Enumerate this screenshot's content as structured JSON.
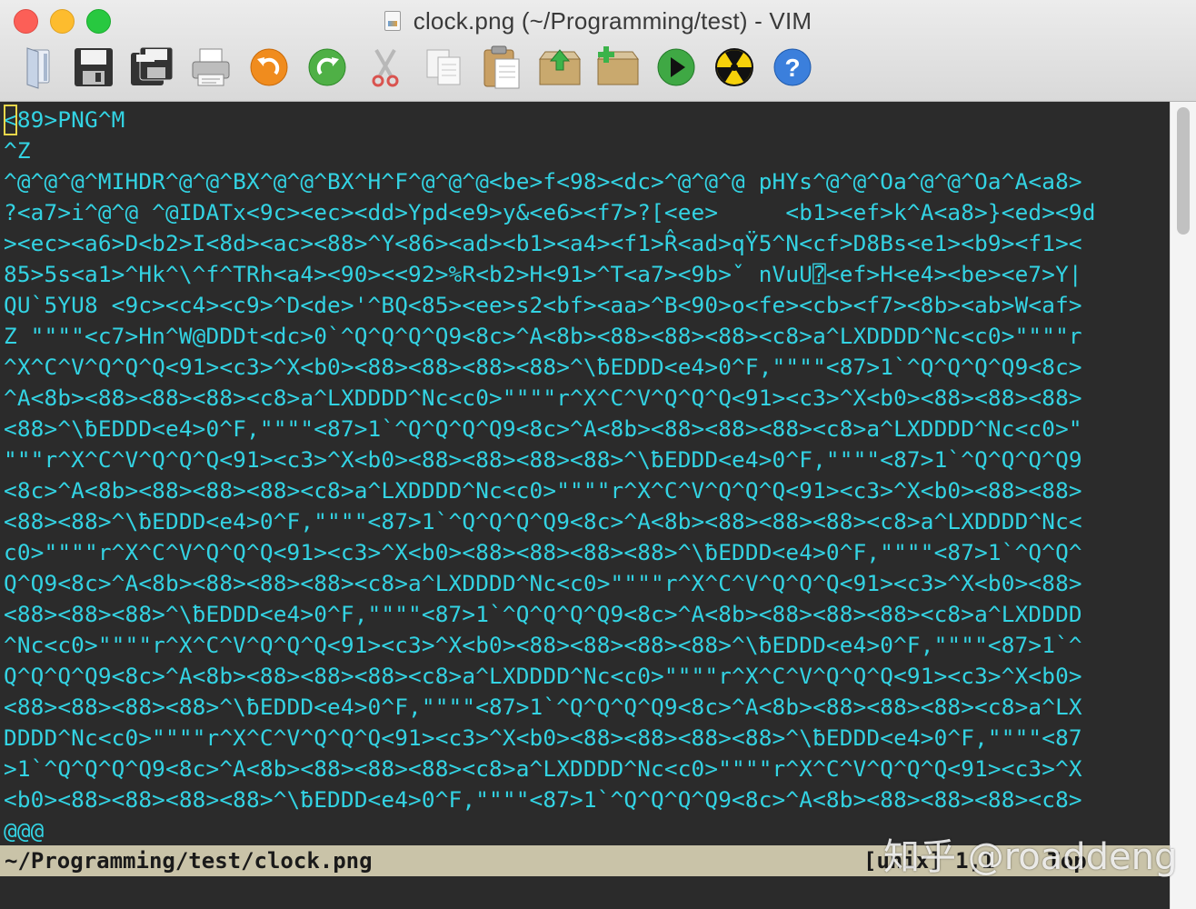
{
  "window": {
    "title": "clock.png (~/Programming/test) - VIM"
  },
  "toolbar": {
    "buttons": [
      {
        "name": "open-icon"
      },
      {
        "name": "save-icon"
      },
      {
        "name": "save-all-icon"
      },
      {
        "name": "print-icon"
      },
      {
        "name": "undo-icon"
      },
      {
        "name": "redo-icon"
      },
      {
        "name": "cut-icon"
      },
      {
        "name": "copy-icon"
      },
      {
        "name": "paste-icon"
      },
      {
        "name": "load-session-icon"
      },
      {
        "name": "save-session-icon"
      },
      {
        "name": "run-script-icon"
      },
      {
        "name": "make-icon"
      },
      {
        "name": "help-icon"
      }
    ]
  },
  "editor": {
    "cursor_char": "<",
    "lines": [
      "89>PNG^M",
      "^Z",
      "^@^@^@^MIHDR^@^@^BX^@^@^BX^H^F^@^@^@<be>f<98><dc>^@^@^@ pHYs^@^@^Oa^@^@^Oa^A<a8>",
      "?<a7>i^@^@ ^@IDATx<9c><ec><dd>Ypd<e9>y&<e6><f7>?[<ee>     <b1><ef>k^A<a8>}<ed><9d",
      "><ec><a6>D<b2>I<8d><ac><88>^Y<86><ad><b1><a4><f1>R̂<ad>qŸ5^N<cf>D8Bs<e1><b9><f1><",
      "85>5s<a1>^Hk^\\^f^TRh<a4><90><<92>%R<b2>H<91>^T<a7><9b>ˇ nVuU⍰<ef>H<e4><be><e7>Y|",
      "QU`5YU8 <9c><c4><c9>^D<de>'^BQ<85><ee>s2<bf><aa>^B<90>o<fe><cb><f7><8b><ab>W<af>",
      "Z \"\"\"\"<c7>Hn^W@DDDt<dc>0`^Q^Q^Q^Q9<8c>^A<8b><88><88><88><c8>a^LXDDDD^Nc<c0>\"\"\"\"r",
      "^X^C^V^Q^Q^Q<91><c3>^X<b0><88><88><88><88>^\\ƀEDDD<e4>0^F,\"\"\"\"<87>1`^Q^Q^Q^Q9<8c>",
      "^A<8b><88><88><88><c8>a^LXDDDD^Nc<c0>\"\"\"\"r^X^C^V^Q^Q^Q<91><c3>^X<b0><88><88><88>",
      "<88>^\\ƀEDDD<e4>0^F,\"\"\"\"<87>1`^Q^Q^Q^Q9<8c>^A<8b><88><88><88><c8>a^LXDDDD^Nc<c0>\"",
      "\"\"\"r^X^C^V^Q^Q^Q<91><c3>^X<b0><88><88><88><88>^\\ƀEDDD<e4>0^F,\"\"\"\"<87>1`^Q^Q^Q^Q9",
      "<8c>^A<8b><88><88><88><c8>a^LXDDDD^Nc<c0>\"\"\"\"r^X^C^V^Q^Q^Q<91><c3>^X<b0><88><88>",
      "<88><88>^\\ƀEDDD<e4>0^F,\"\"\"\"<87>1`^Q^Q^Q^Q9<8c>^A<8b><88><88><88><c8>a^LXDDDD^Nc<",
      "c0>\"\"\"\"r^X^C^V^Q^Q^Q<91><c3>^X<b0><88><88><88><88>^\\ƀEDDD<e4>0^F,\"\"\"\"<87>1`^Q^Q^",
      "Q^Q9<8c>^A<8b><88><88><88><c8>a^LXDDDD^Nc<c0>\"\"\"\"r^X^C^V^Q^Q^Q<91><c3>^X<b0><88>",
      "<88><88><88>^\\ƀEDDD<e4>0^F,\"\"\"\"<87>1`^Q^Q^Q^Q9<8c>^A<8b><88><88><88><c8>a^LXDDDD",
      "^Nc<c0>\"\"\"\"r^X^C^V^Q^Q^Q<91><c3>^X<b0><88><88><88><88>^\\ƀEDDD<e4>0^F,\"\"\"\"<87>1`^",
      "Q^Q^Q^Q9<8c>^A<8b><88><88><88><c8>a^LXDDDD^Nc<c0>\"\"\"\"r^X^C^V^Q^Q^Q<91><c3>^X<b0>",
      "<88><88><88><88>^\\ƀEDDD<e4>0^F,\"\"\"\"<87>1`^Q^Q^Q^Q9<8c>^A<8b><88><88><88><c8>a^LX",
      "DDDD^Nc<c0>\"\"\"\"r^X^C^V^Q^Q^Q<91><c3>^X<b0><88><88><88><88>^\\ƀEDDD<e4>0^F,\"\"\"\"<87",
      ">1`^Q^Q^Q^Q9<8c>^A<8b><88><88><88><c8>a^LXDDDD^Nc<c0>\"\"\"\"r^X^C^V^Q^Q^Q<91><c3>^X",
      "<b0><88><88><88><88>^\\ƀEDDD<e4>0^F,\"\"\"\"<87>1`^Q^Q^Q^Q9<8c>^A<8b><88><88><88><c8>",
      "@@@"
    ]
  },
  "statusline": {
    "filename": "~/Programming/test/clock.png",
    "right": "[unix] 1,1    Top"
  },
  "watermark": "知乎 @roaddeng"
}
